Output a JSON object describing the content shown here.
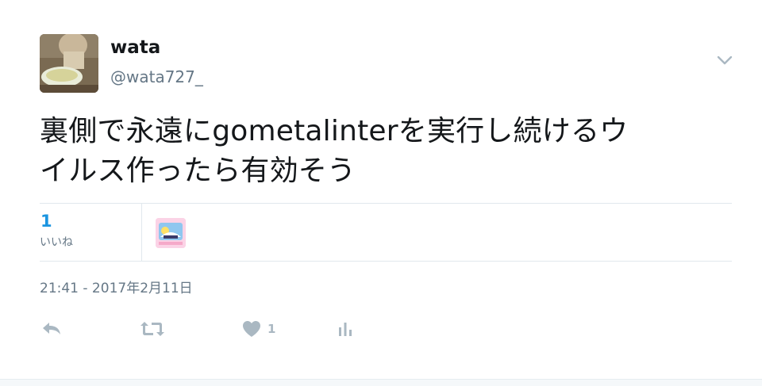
{
  "user": {
    "name": "wata",
    "handle": "@wata727_"
  },
  "tweet": {
    "text_line1": "裏側で永遠にgometalinterを実行し続けるウ",
    "text_line2": "イルス作ったら有効そう",
    "timestamp": "21:41 - 2017年2月11日"
  },
  "stats": {
    "likes_count": "1",
    "likes_label": "いいね"
  },
  "actions": {
    "like_count": "1"
  },
  "icons": {
    "caret": "chevron-down-icon",
    "reply": "reply-icon",
    "retweet": "retweet-icon",
    "like": "heart-icon",
    "analytics": "analytics-icon"
  },
  "colors": {
    "link_blue": "#1b95e0",
    "secondary_text": "#657786",
    "action_gray": "#aab8c2",
    "divider": "#e1e8ed"
  }
}
